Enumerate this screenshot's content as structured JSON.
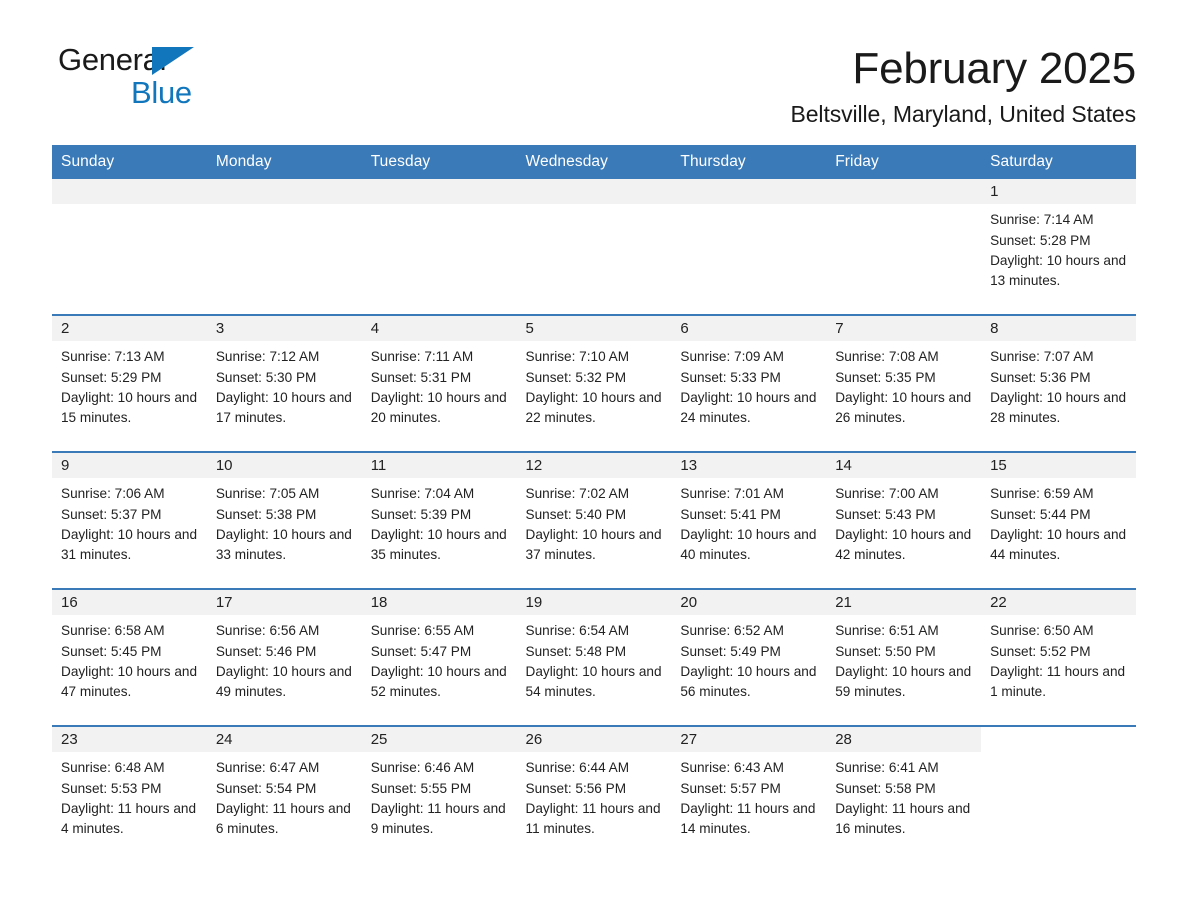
{
  "brand": {
    "name_part1": "General",
    "name_part2": "Blue",
    "accent_color": "#1276bc",
    "triangle_icon": "triangle-icon"
  },
  "header": {
    "month_title": "February 2025",
    "location": "Beltsville, Maryland, United States"
  },
  "calendar": {
    "header_bg": "#3a7ab8",
    "daynum_band_bg": "#f2f2f2",
    "weekday_headers": [
      "Sunday",
      "Monday",
      "Tuesday",
      "Wednesday",
      "Thursday",
      "Friday",
      "Saturday"
    ],
    "weeks": [
      [
        {
          "day": "",
          "sunrise": "",
          "sunset": "",
          "daylight": "",
          "empty": true
        },
        {
          "day": "",
          "sunrise": "",
          "sunset": "",
          "daylight": "",
          "empty": true
        },
        {
          "day": "",
          "sunrise": "",
          "sunset": "",
          "daylight": "",
          "empty": true
        },
        {
          "day": "",
          "sunrise": "",
          "sunset": "",
          "daylight": "",
          "empty": true
        },
        {
          "day": "",
          "sunrise": "",
          "sunset": "",
          "daylight": "",
          "empty": true
        },
        {
          "day": "",
          "sunrise": "",
          "sunset": "",
          "daylight": "",
          "empty": true
        },
        {
          "day": "1",
          "sunrise": "Sunrise: 7:14 AM",
          "sunset": "Sunset: 5:28 PM",
          "daylight": "Daylight: 10 hours and 13 minutes."
        }
      ],
      [
        {
          "day": "2",
          "sunrise": "Sunrise: 7:13 AM",
          "sunset": "Sunset: 5:29 PM",
          "daylight": "Daylight: 10 hours and 15 minutes."
        },
        {
          "day": "3",
          "sunrise": "Sunrise: 7:12 AM",
          "sunset": "Sunset: 5:30 PM",
          "daylight": "Daylight: 10 hours and 17 minutes."
        },
        {
          "day": "4",
          "sunrise": "Sunrise: 7:11 AM",
          "sunset": "Sunset: 5:31 PM",
          "daylight": "Daylight: 10 hours and 20 minutes."
        },
        {
          "day": "5",
          "sunrise": "Sunrise: 7:10 AM",
          "sunset": "Sunset: 5:32 PM",
          "daylight": "Daylight: 10 hours and 22 minutes."
        },
        {
          "day": "6",
          "sunrise": "Sunrise: 7:09 AM",
          "sunset": "Sunset: 5:33 PM",
          "daylight": "Daylight: 10 hours and 24 minutes."
        },
        {
          "day": "7",
          "sunrise": "Sunrise: 7:08 AM",
          "sunset": "Sunset: 5:35 PM",
          "daylight": "Daylight: 10 hours and 26 minutes."
        },
        {
          "day": "8",
          "sunrise": "Sunrise: 7:07 AM",
          "sunset": "Sunset: 5:36 PM",
          "daylight": "Daylight: 10 hours and 28 minutes."
        }
      ],
      [
        {
          "day": "9",
          "sunrise": "Sunrise: 7:06 AM",
          "sunset": "Sunset: 5:37 PM",
          "daylight": "Daylight: 10 hours and 31 minutes."
        },
        {
          "day": "10",
          "sunrise": "Sunrise: 7:05 AM",
          "sunset": "Sunset: 5:38 PM",
          "daylight": "Daylight: 10 hours and 33 minutes."
        },
        {
          "day": "11",
          "sunrise": "Sunrise: 7:04 AM",
          "sunset": "Sunset: 5:39 PM",
          "daylight": "Daylight: 10 hours and 35 minutes."
        },
        {
          "day": "12",
          "sunrise": "Sunrise: 7:02 AM",
          "sunset": "Sunset: 5:40 PM",
          "daylight": "Daylight: 10 hours and 37 minutes."
        },
        {
          "day": "13",
          "sunrise": "Sunrise: 7:01 AM",
          "sunset": "Sunset: 5:41 PM",
          "daylight": "Daylight: 10 hours and 40 minutes."
        },
        {
          "day": "14",
          "sunrise": "Sunrise: 7:00 AM",
          "sunset": "Sunset: 5:43 PM",
          "daylight": "Daylight: 10 hours and 42 minutes."
        },
        {
          "day": "15",
          "sunrise": "Sunrise: 6:59 AM",
          "sunset": "Sunset: 5:44 PM",
          "daylight": "Daylight: 10 hours and 44 minutes."
        }
      ],
      [
        {
          "day": "16",
          "sunrise": "Sunrise: 6:58 AM",
          "sunset": "Sunset: 5:45 PM",
          "daylight": "Daylight: 10 hours and 47 minutes."
        },
        {
          "day": "17",
          "sunrise": "Sunrise: 6:56 AM",
          "sunset": "Sunset: 5:46 PM",
          "daylight": "Daylight: 10 hours and 49 minutes."
        },
        {
          "day": "18",
          "sunrise": "Sunrise: 6:55 AM",
          "sunset": "Sunset: 5:47 PM",
          "daylight": "Daylight: 10 hours and 52 minutes."
        },
        {
          "day": "19",
          "sunrise": "Sunrise: 6:54 AM",
          "sunset": "Sunset: 5:48 PM",
          "daylight": "Daylight: 10 hours and 54 minutes."
        },
        {
          "day": "20",
          "sunrise": "Sunrise: 6:52 AM",
          "sunset": "Sunset: 5:49 PM",
          "daylight": "Daylight: 10 hours and 56 minutes."
        },
        {
          "day": "21",
          "sunrise": "Sunrise: 6:51 AM",
          "sunset": "Sunset: 5:50 PM",
          "daylight": "Daylight: 10 hours and 59 minutes."
        },
        {
          "day": "22",
          "sunrise": "Sunrise: 6:50 AM",
          "sunset": "Sunset: 5:52 PM",
          "daylight": "Daylight: 11 hours and 1 minute."
        }
      ],
      [
        {
          "day": "23",
          "sunrise": "Sunrise: 6:48 AM",
          "sunset": "Sunset: 5:53 PM",
          "daylight": "Daylight: 11 hours and 4 minutes."
        },
        {
          "day": "24",
          "sunrise": "Sunrise: 6:47 AM",
          "sunset": "Sunset: 5:54 PM",
          "daylight": "Daylight: 11 hours and 6 minutes."
        },
        {
          "day": "25",
          "sunrise": "Sunrise: 6:46 AM",
          "sunset": "Sunset: 5:55 PM",
          "daylight": "Daylight: 11 hours and 9 minutes."
        },
        {
          "day": "26",
          "sunrise": "Sunrise: 6:44 AM",
          "sunset": "Sunset: 5:56 PM",
          "daylight": "Daylight: 11 hours and 11 minutes."
        },
        {
          "day": "27",
          "sunrise": "Sunrise: 6:43 AM",
          "sunset": "Sunset: 5:57 PM",
          "daylight": "Daylight: 11 hours and 14 minutes."
        },
        {
          "day": "28",
          "sunrise": "Sunrise: 6:41 AM",
          "sunset": "Sunset: 5:58 PM",
          "daylight": "Daylight: 11 hours and 16 minutes."
        },
        {
          "day": "",
          "sunrise": "",
          "sunset": "",
          "daylight": "",
          "blank": true
        }
      ]
    ]
  }
}
